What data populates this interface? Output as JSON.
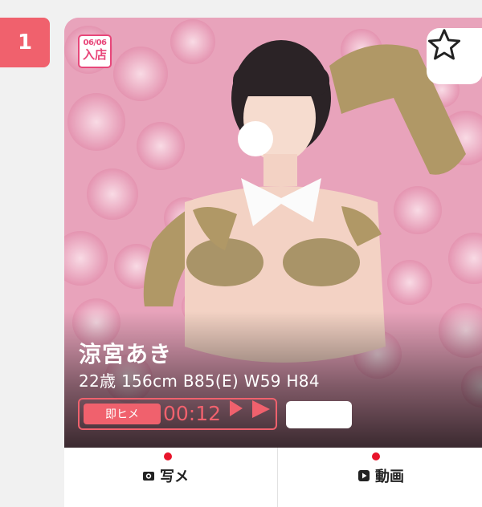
{
  "rank": "1",
  "card": {
    "new_badge": {
      "date": "06/06",
      "text": "入店"
    },
    "profile": {
      "name": "涼宮あき",
      "specs": "22歳 156cm B85(E) W59 H84"
    },
    "status": {
      "label": "即ヒメ",
      "time": "00:12"
    },
    "tabs": [
      {
        "label": "写メ",
        "icon": "camera-icon"
      },
      {
        "label": "動画",
        "icon": "play-icon"
      }
    ]
  },
  "colors": {
    "accent": "#f0616d",
    "new_badge": "#e8477a",
    "notify_dot": "#e8142b"
  }
}
